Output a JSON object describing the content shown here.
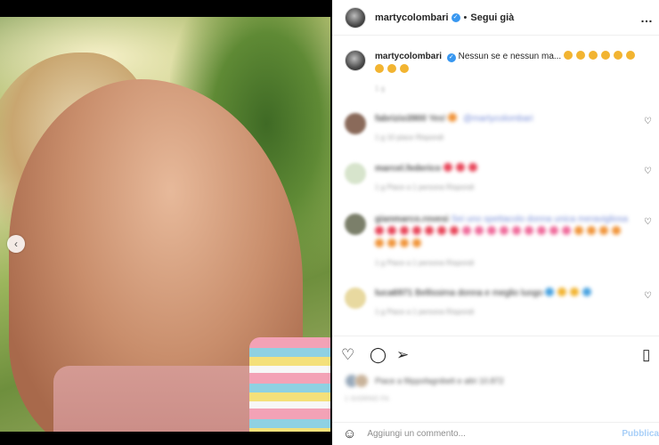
{
  "post": {
    "username": "martycolombari",
    "separator": "•",
    "follow_label": "Segui già",
    "more_icon": "…",
    "caption_text": "Nessun se e nessun ma...",
    "caption_time": "1 g",
    "nav_prev_icon": "‹"
  },
  "comments": [
    {
      "user": "fabrizio3900",
      "text": "Yes! ",
      "mention": "@martycolombari",
      "meta": "1 g   10 piace   Rispondi"
    },
    {
      "user": "marcel.federico",
      "text": "",
      "meta": "1 g   Piace a 1 persona   Rispondi"
    },
    {
      "user": "gianmarco.rovesi",
      "text": "Sei uno spettacolo donna unica meravigliosa",
      "meta": "1 g   Piace a 1 persona   Rispondi"
    },
    {
      "user": "luca6971",
      "text": "Bellissima donna e meglio luogo",
      "meta": "1 g   Piace a 1 persona   Rispondi"
    }
  ],
  "likes": {
    "text": "Piace a filippofagnibelt e altri 10.872"
  },
  "date": "1 GIORNO FA",
  "comment_box": {
    "placeholder": "Aggiungi un commento...",
    "publish_label": "Pubblica"
  },
  "colors": {
    "verified": "#3897f0",
    "publish_disabled": "#a8cff8",
    "mention": "#7a8fd8"
  }
}
